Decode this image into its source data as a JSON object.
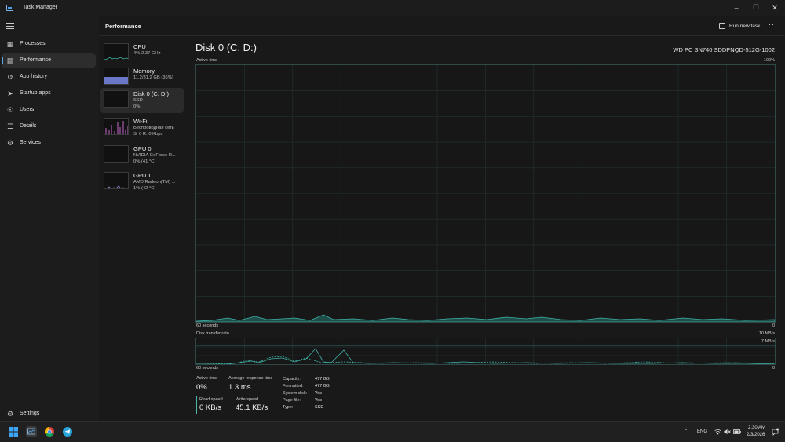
{
  "window": {
    "title": "Task Manager"
  },
  "nav": {
    "items": [
      {
        "label": "Processes",
        "icon": "processes-icon"
      },
      {
        "label": "Performance",
        "icon": "performance-icon"
      },
      {
        "label": "App history",
        "icon": "app-history-icon"
      },
      {
        "label": "Startup apps",
        "icon": "startup-apps-icon"
      },
      {
        "label": "Users",
        "icon": "users-icon"
      },
      {
        "label": "Details",
        "icon": "details-icon"
      },
      {
        "label": "Services",
        "icon": "services-icon"
      }
    ],
    "active": "Performance",
    "settings_label": "Settings"
  },
  "header": {
    "section_title": "Performance",
    "run_task_label": "Run new task",
    "more_label": "···"
  },
  "devices": [
    {
      "name": "CPU",
      "sub1": "4%  2.37 GHz",
      "sub2": ""
    },
    {
      "name": "Memory",
      "sub1": "11.2/31.2 GB (36%)",
      "sub2": ""
    },
    {
      "name": "Disk 0 (C: D:)",
      "sub1": "SSD",
      "sub2": "0%"
    },
    {
      "name": "Wi-Fi",
      "sub1": "Беспроводная сеть",
      "sub2": "S: 0  R: 0 Kbps"
    },
    {
      "name": "GPU 0",
      "sub1": "NVIDIA GeForce R...",
      "sub2": "0%  (41 °C)"
    },
    {
      "name": "GPU 1",
      "sub1": "AMD Radeon(TM) ...",
      "sub2": "1%  (42 °C)"
    }
  ],
  "main": {
    "title": "Disk 0 (C: D:)",
    "model": "WD PC SN740 SDDPNQD-512G-1002",
    "active_chart": {
      "label": "Active time",
      "max_label": "100%",
      "x_left": "60 seconds",
      "x_right": "0"
    },
    "transfer_chart": {
      "label": "Disk transfer rate",
      "max_label": "10 MB/s",
      "marker_label": "7 MB/s",
      "x_left": "60 seconds",
      "x_right": "0"
    }
  },
  "stats": {
    "active_time_label": "Active time",
    "active_time_value": "0%",
    "avg_response_label": "Average response time",
    "avg_response_value": "1.3 ms",
    "read_label": "Read speed",
    "read_value": "0 KB/s",
    "write_label": "Write speed",
    "write_value": "45.1 KB/s",
    "details": [
      {
        "key": "Capacity:",
        "value": "477 GB"
      },
      {
        "key": "Formatted:",
        "value": "477 GB"
      },
      {
        "key": "System disk:",
        "value": "Yes"
      },
      {
        "key": "Page file:",
        "value": "Yes"
      },
      {
        "key": "Type:",
        "value": "SSD"
      }
    ]
  },
  "taskbar": {
    "lang": "ENG",
    "time": "2:30 AM",
    "date": "2/3/2026"
  },
  "colors": {
    "accent": "#5aa9e6",
    "disk_line": "#3fb3a8",
    "memory_fill": "#6a77c9",
    "wifi_line": "#c86ad0"
  }
}
